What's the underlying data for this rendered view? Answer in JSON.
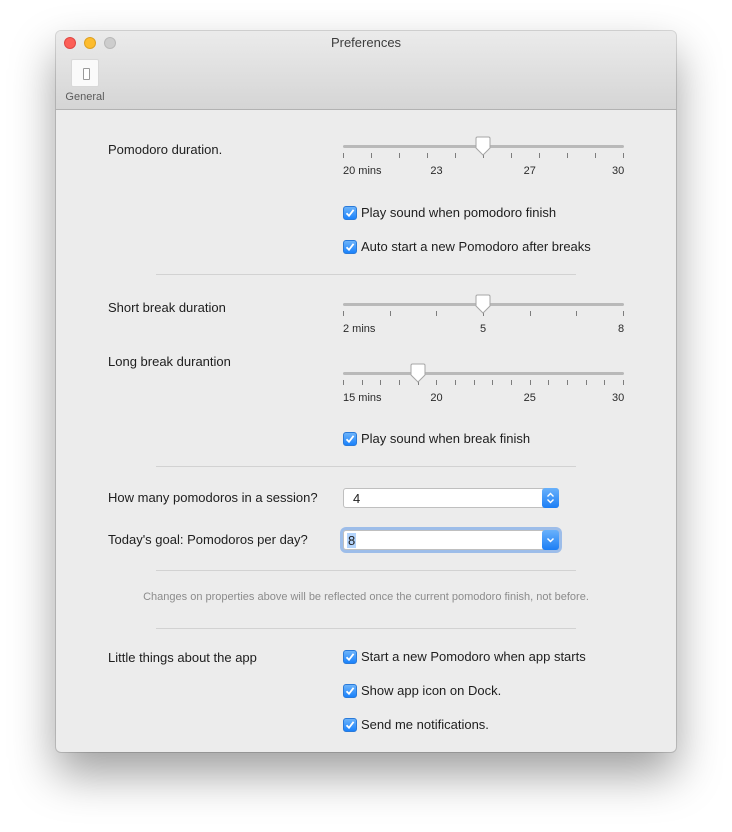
{
  "window": {
    "title": "Preferences"
  },
  "toolbar": {
    "tab_general": "General",
    "tab_icon": "switch-icon"
  },
  "pomodoro": {
    "label": "Pomodoro duration.",
    "slider": {
      "min": 20,
      "max": 30,
      "value": 25,
      "tick_count": 11,
      "tick_labels": [
        "20 mins",
        "23",
        "27",
        "30"
      ]
    },
    "play_sound": {
      "label": "Play sound when pomodoro finish",
      "checked": true
    },
    "auto_start": {
      "label": "Auto start a new Pomodoro after breaks",
      "checked": true
    }
  },
  "short_break": {
    "label": "Short break duration",
    "slider": {
      "min": 2,
      "max": 8,
      "value": 5,
      "tick_count": 7,
      "tick_labels": [
        "2 mins",
        "5",
        "8"
      ]
    }
  },
  "long_break": {
    "label": "Long break durantion",
    "slider": {
      "min": 15,
      "max": 30,
      "value": 19,
      "tick_count": 16,
      "tick_labels": [
        "15 mins",
        "20",
        "25",
        "30"
      ]
    },
    "play_sound": {
      "label": "Play sound when break finish",
      "checked": true
    }
  },
  "session": {
    "pomodoros_label": "How many pomodoros in a session?",
    "pomodoros_value": "4",
    "goal_label": "Today's goal: Pomodoros per day?",
    "goal_value": "8"
  },
  "note": "Changes on properties above will be reflected once the current pomodoro finish, not before.",
  "little_things": {
    "label": "Little things about the app",
    "start_on_launch": {
      "label": "Start a new Pomodoro when app starts",
      "checked": true
    },
    "dock_icon": {
      "label": "Show app icon on Dock.",
      "checked": true
    },
    "notifications": {
      "label": "Send me notifications.",
      "checked": true
    }
  },
  "colors": {
    "accent": "#1a82fb",
    "window_bg": "#ececec",
    "close": "#fc5f57",
    "minimize": "#fdbc2e"
  }
}
